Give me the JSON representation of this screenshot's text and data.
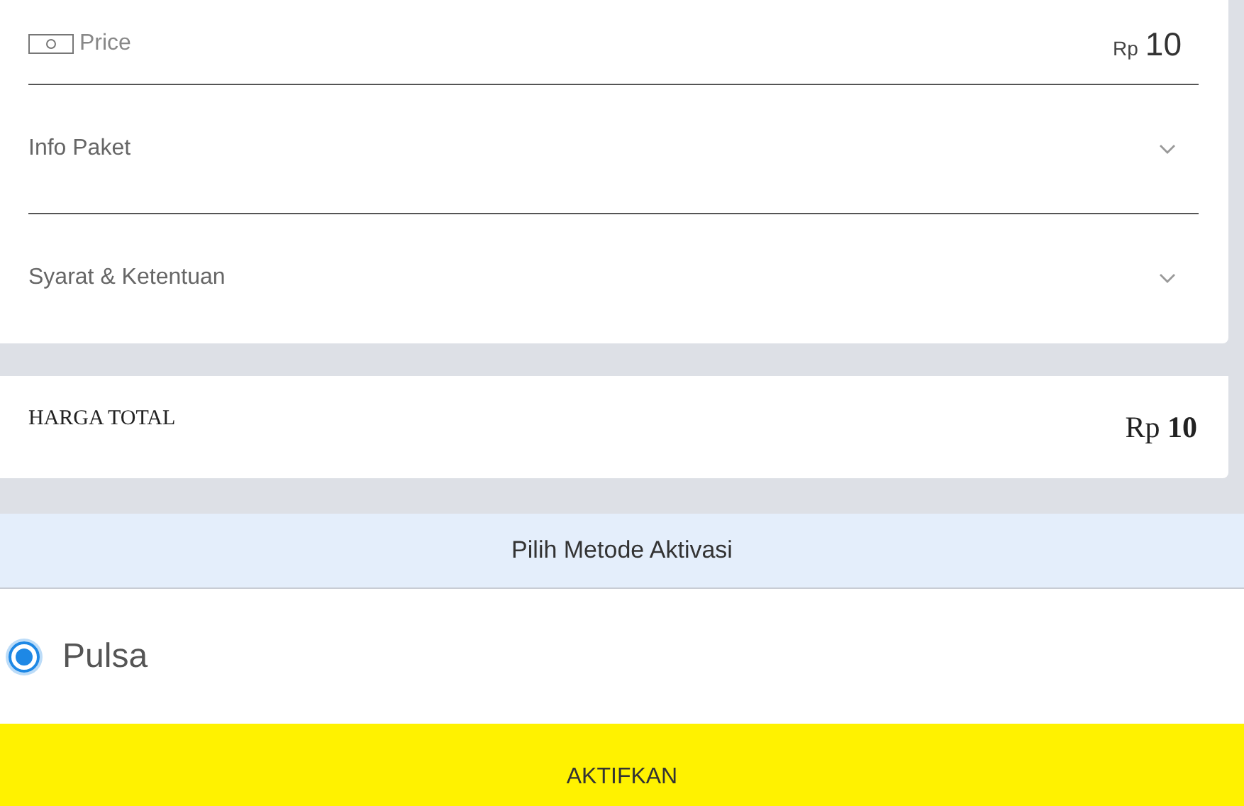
{
  "price_row": {
    "label": "Price",
    "currency": "Rp",
    "amount": "10"
  },
  "sections": [
    {
      "title": "Info Paket",
      "expanded": false
    },
    {
      "title": "Syarat & Ketentuan",
      "expanded": false
    }
  ],
  "total": {
    "label": "HARGA TOTAL",
    "currency": "Rp",
    "amount": "10"
  },
  "activation": {
    "title": "Pilih Metode Aktivasi",
    "options": [
      {
        "label": "Pulsa",
        "selected": true
      }
    ]
  },
  "submit_button": "AKTIFKAN"
}
